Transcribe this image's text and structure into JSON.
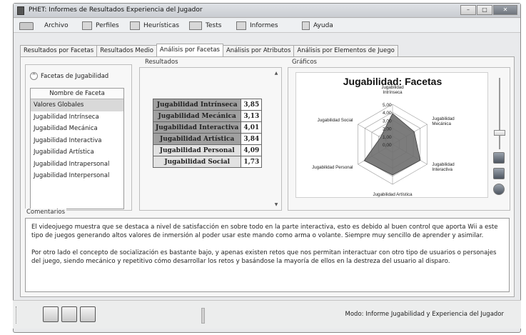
{
  "window": {
    "title": "PHET: Informes de Resultados Experiencia del Jugador",
    "controls": [
      "minimize-icon",
      "maximize-icon",
      "close-icon"
    ]
  },
  "menu": {
    "items": [
      {
        "label": "Archivo",
        "icon": "folder-icon"
      },
      {
        "label": "Perfiles",
        "icon": "users-icon"
      },
      {
        "label": "Heurísticas",
        "icon": "list-icon"
      },
      {
        "label": "Tests",
        "icon": "grid-icon"
      },
      {
        "label": "Informes",
        "icon": "chart-icon"
      },
      {
        "label": "Ayuda",
        "icon": "book-icon"
      }
    ]
  },
  "tabs": [
    {
      "label": "Resultados por Facetas",
      "active": false
    },
    {
      "label": "Resultados Medio",
      "active": false
    },
    {
      "label": "Análisis por Facetas",
      "active": true
    },
    {
      "label": "Análisis por Atributos",
      "active": false
    },
    {
      "label": "Análisis por Elementos de Juego",
      "active": false
    }
  ],
  "facets": {
    "toggle_label": "Facetas de Jugabilidad",
    "list_header": "Nombre de Faceta",
    "items": [
      "Valores Globales",
      "Jugabilidad Intrínseca",
      "Jugabilidad Mecánica",
      "Jugabilidad Interactiva",
      "Jugabilidad Artística",
      "Jugabilidad Intrapersonal",
      "Jugabilidad Interpersonal"
    ],
    "selected_index": 0
  },
  "results": {
    "label": "Resultados",
    "rows": [
      {
        "name": "Jugabilidad Intrínseca",
        "value": "3,85",
        "shade": "dark"
      },
      {
        "name": "Jugabilidad Mecánica",
        "value": "3,13",
        "shade": "dark"
      },
      {
        "name": "Jugabilidad Interactiva",
        "value": "4,01",
        "shade": "dark"
      },
      {
        "name": "Jugabilidad Artística",
        "value": "3,84",
        "shade": "dark"
      },
      {
        "name": "Jugabilidad Personal",
        "value": "4,09",
        "shade": "light"
      },
      {
        "name": "Jugabilidad Social",
        "value": "1,73",
        "shade": "light"
      }
    ]
  },
  "graphs": {
    "label": "Gráficos",
    "buttons": [
      "bar-chart-icon",
      "column-chart-icon",
      "pie-chart-icon"
    ]
  },
  "chart_data": {
    "type": "radar",
    "title": "Jugabilidad: Facetas",
    "categories": [
      "Jugabilidad Intrínseca",
      "Jugabilidad Mecánica",
      "Jugabilidad Interactiva",
      "Jugabilidad Artística",
      "Jugabilidad Personal",
      "Jugabilidad Social"
    ],
    "values": [
      3.85,
      3.13,
      4.01,
      3.84,
      4.09,
      1.73
    ],
    "rlim": [
      0,
      5
    ],
    "ticks": [
      "0,00",
      "1,00",
      "2,00",
      "3,00",
      "4,00",
      "5,00"
    ],
    "fill_color": "#6e6e6e",
    "grid": true
  },
  "comments": {
    "label": "Comentarios",
    "paragraphs": [
      "El videojuego muestra que se destaca a nivel de satisfacción en sobre todo en la parte interactiva, esto es debido al buen control que aporta Wii a este tipo de juegos generando altos valores de inmersión al poder usar este mando como arma o volante. Siempre muy sencillo de aprender y asimilar.",
      "Por otro lado el concepto de socialización es bastante bajo, y apenas existen retos que nos permitan interactuar con otro tipo de usuarios o personajes del juego, siendo mecánico y repetitivo cómo desarrollar los retos y basándose la mayoría de ellos en la destreza del usuario al disparo."
    ]
  },
  "statusbar": {
    "buttons": [
      "open-folder-icon",
      "save-icon",
      "print-icon"
    ],
    "mode_text": "Modo: Informe Jugabilidad y Experiencia del Jugador"
  }
}
